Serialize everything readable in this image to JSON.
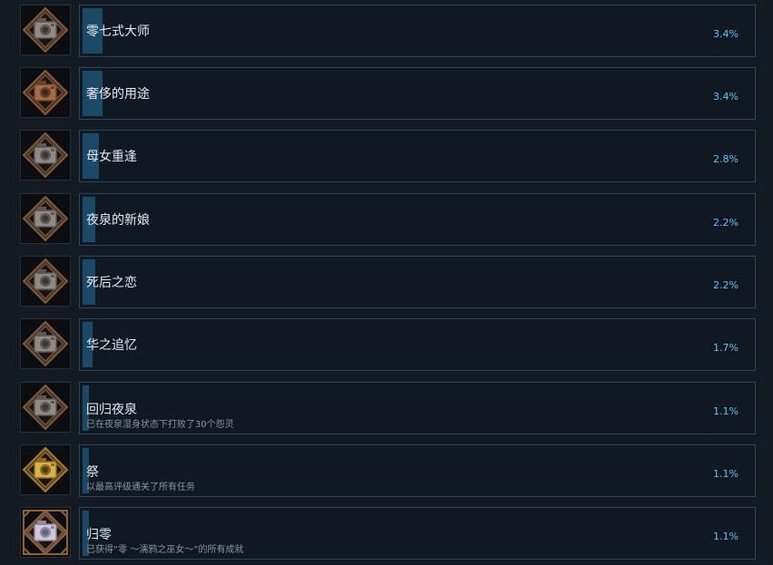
{
  "colors": {
    "background": "#131a22",
    "card_border": "#27485c",
    "progress_fill": "#1a4a68",
    "percent_text": "#66c0f4"
  },
  "achievements": [
    {
      "title": "零七式大师",
      "description": "",
      "percent": "3.4%",
      "fill": 0.034,
      "icon": "silver-camera-icon"
    },
    {
      "title": "奢侈的用途",
      "description": "",
      "percent": "3.4%",
      "fill": 0.034,
      "icon": "bronze-camera-icon"
    },
    {
      "title": "母女重逢",
      "description": "",
      "percent": "2.8%",
      "fill": 0.028,
      "icon": "silver-camera-icon"
    },
    {
      "title": "夜泉的新娘",
      "description": "",
      "percent": "2.2%",
      "fill": 0.022,
      "icon": "silver-camera-icon"
    },
    {
      "title": "死后之恋",
      "description": "",
      "percent": "2.2%",
      "fill": 0.022,
      "icon": "silver-camera-icon"
    },
    {
      "title": "华之追忆",
      "description": "",
      "percent": "1.7%",
      "fill": 0.017,
      "icon": "silver-camera-icon"
    },
    {
      "title": "回归夜泉",
      "description": "已在夜泉湿身状态下打败了30个怨灵",
      "percent": "1.1%",
      "fill": 0.011,
      "icon": "silver-camera-icon"
    },
    {
      "title": "祭",
      "description": "以最高评级通关了所有任务",
      "percent": "1.1%",
      "fill": 0.011,
      "icon": "gold-camera-icon"
    },
    {
      "title": "归零",
      "description": "已获得“零 ～濡鸦之巫女～”的所有成就",
      "percent": "1.1%",
      "fill": 0.011,
      "icon": "platinum-camera-icon"
    }
  ]
}
